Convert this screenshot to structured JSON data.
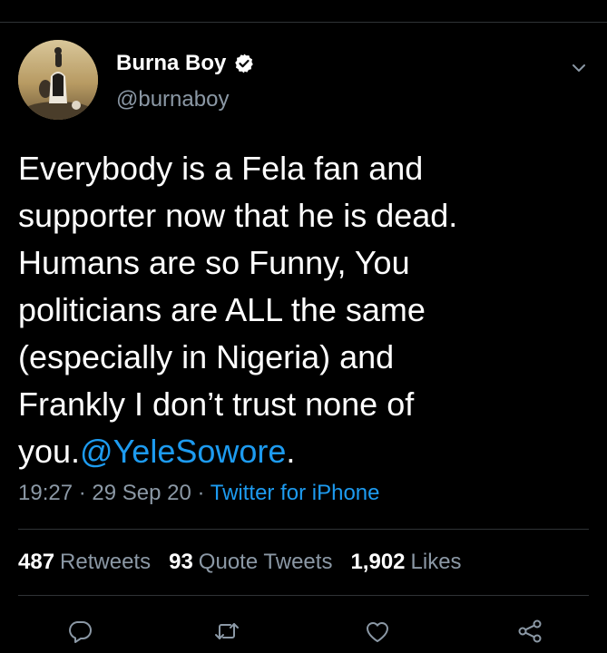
{
  "tweet": {
    "author": {
      "display_name": "Burna Boy",
      "handle": "@burnaboy",
      "verified": true
    },
    "text_lines": [
      "Everybody is a Fela fan and",
      "supporter now that he is dead.",
      "Humans are so Funny, You",
      "politicians are ALL the same",
      "(especially in Nigeria) and",
      "Frankly I don’t trust none of"
    ],
    "last_line_prefix": "you.",
    "mention": "@YeleSowore",
    "last_line_suffix": ".",
    "time": "19:27",
    "separator": " · ",
    "date": "29 Sep 20",
    "source": "Twitter for iPhone"
  },
  "stats": {
    "retweets_count": "487",
    "retweets_label": "Retweets",
    "quotes_count": "93",
    "quotes_label": "Quote Tweets",
    "likes_count": "1,902",
    "likes_label": "Likes"
  },
  "actions": [
    "reply-icon",
    "retweet-icon",
    "like-icon",
    "share-icon"
  ],
  "colors": {
    "background": "#000000",
    "text": "#ffffff",
    "secondary": "#8b98a5",
    "accent": "#1d9bf0",
    "divider": "#2f3336"
  }
}
